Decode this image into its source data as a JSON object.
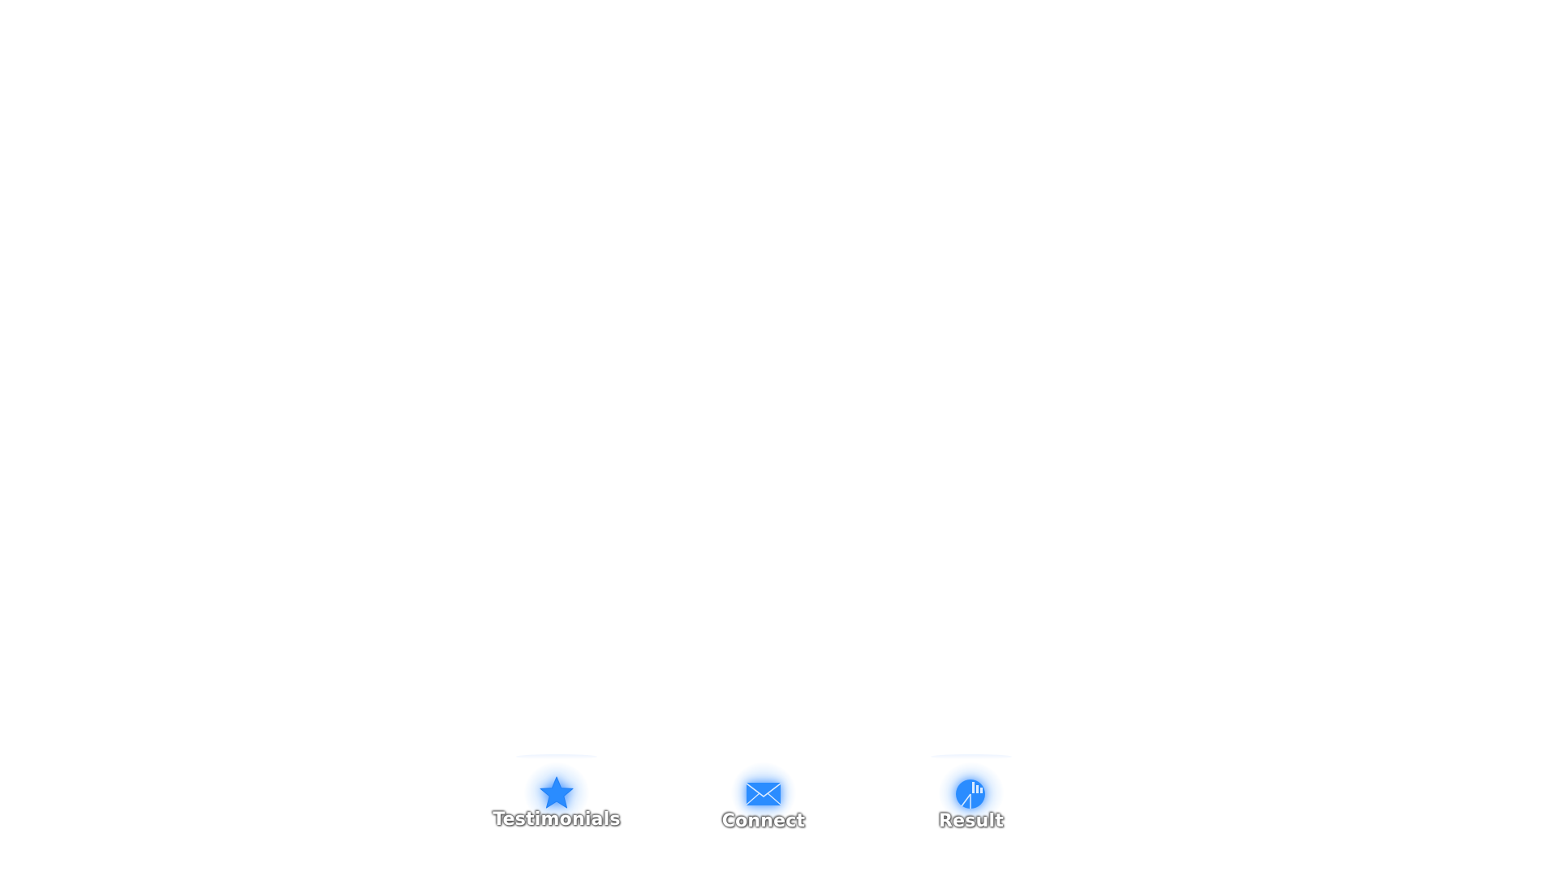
{
  "nav": {
    "items": [
      {
        "label": "Testimonials",
        "icon": "star-icon"
      },
      {
        "label": "Connect",
        "icon": "envelope-icon"
      },
      {
        "label": "Result",
        "icon": "pie-chart-icon"
      }
    ]
  },
  "colors": {
    "background": "#ffffff",
    "icon": "#2a8cff",
    "glow": "#78b4ff",
    "label_text": "#ffffff"
  }
}
